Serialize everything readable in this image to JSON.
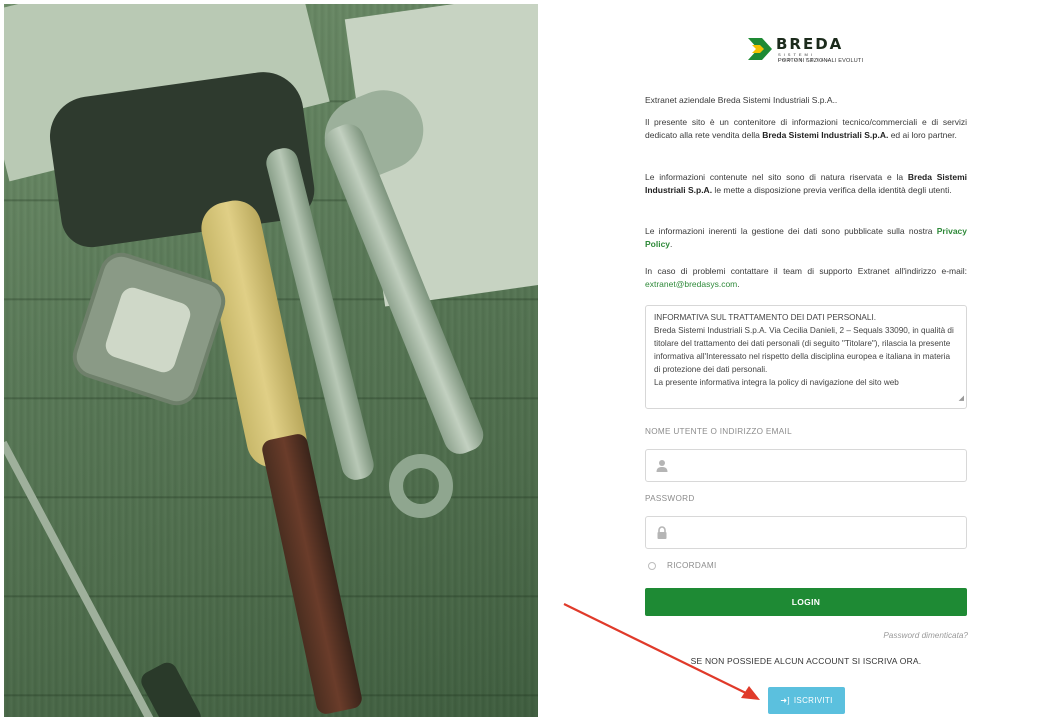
{
  "brand": {
    "name": "BREDA",
    "subtitle_top": "SISTEMI INDUSTRIALI",
    "subtitle_bottom": "PORTONI SEZIONALI EVOLUTI",
    "colors": {
      "green": "#1e8a34",
      "yellow": "#f2c200",
      "dark": "#1c2b1c"
    }
  },
  "intro": {
    "line1": "Extranet aziendale Breda Sistemi Industriali S.p.A..",
    "p2_a": "Il presente sito è un contenitore di informazioni tecnico/commerciali e di servizi dedicato alla rete vendita della ",
    "p2_b": "Breda Sistemi Industriali S.p.A.",
    "p2_c": " ed ai loro partner.",
    "p3_a": "Le informazioni contenute nel sito sono di natura riservata e la ",
    "p3_b": "Breda Sistemi Industriali S.p.A.",
    "p3_c": " le mette a disposizione previa verifica della identità degli utenti.",
    "p4_a": "Le informazioni inerenti la gestione dei dati sono pubblicate sulla nostra ",
    "p4_link": "Privacy Policy",
    "p4_c": ".",
    "p5_a": "In caso di problemi contattare il team di supporto Extranet all'indirizzo e-mail: ",
    "p5_link": "extranet@bredasys.com",
    "p5_c": "."
  },
  "privacy_box": {
    "title": "INFORMATIVA SUL TRATTAMENTO DEI DATI PERSONALI.",
    "body": "Breda Sistemi Industriali S.p.A. Via Cecilia Danieli, 2 – Sequals 33090, in qualità di titolare del trattamento dei dati personali (di seguito \"Titolare\"), rilascia la presente informativa all'Interessato nel rispetto della disciplina europea e italiana in materia di protezione dei dati personali.",
    "body2": "La presente informativa integra la policy di navigazione del sito web"
  },
  "form": {
    "username_label": "NOME UTENTE O INDIRIZZO EMAIL",
    "username_value": "",
    "password_label": "PASSWORD",
    "password_value": "",
    "remember_label": "RICORDAMI",
    "login_label": "LOGIN",
    "forgot_label": "Password dimenticata?",
    "signup_prompt": "SE NON POSSIEDE ALCUN ACCOUNT SI ISCRIVA ORA.",
    "signup_label": "ISCRIVITI"
  },
  "icons": {
    "user": "user-icon",
    "lock": "lock-icon",
    "signin": "sign-in-icon"
  }
}
